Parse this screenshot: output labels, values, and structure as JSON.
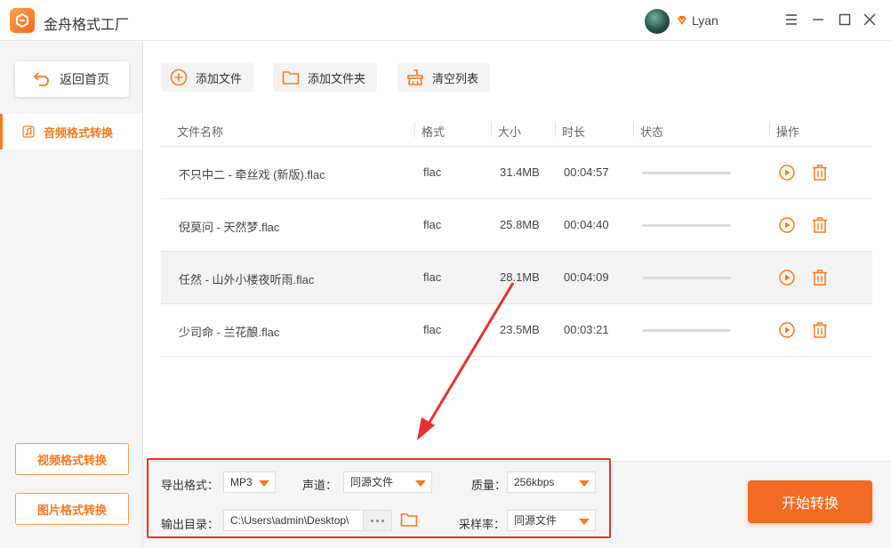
{
  "app": {
    "title": "金舟格式工厂"
  },
  "user": {
    "name": "Lyan"
  },
  "sidebar": {
    "back_label": "返回首页",
    "active_nav": "音频格式转换",
    "video_btn": "视频格式转换",
    "image_btn": "图片格式转换"
  },
  "toolbar": {
    "add_file": "添加文件",
    "add_folder": "添加文件夹",
    "clear_list": "清空列表"
  },
  "table": {
    "headers": {
      "name": "文件名称",
      "format": "格式",
      "size": "大小",
      "duration": "时长",
      "status": "状态",
      "action": "操作"
    },
    "rows": [
      {
        "name": "不只中二 - 牵丝戏 (新版).flac",
        "format": "flac",
        "size": "31.4MB",
        "duration": "00:04:57"
      },
      {
        "name": "倪莫问 - 天然梦.flac",
        "format": "flac",
        "size": "25.8MB",
        "duration": "00:04:40"
      },
      {
        "name": "任然 - 山外小楼夜听雨.flac",
        "format": "flac",
        "size": "28.1MB",
        "duration": "00:04:09"
      },
      {
        "name": "少司命 - 兰花酿.flac",
        "format": "flac",
        "size": "23.5MB",
        "duration": "00:03:21"
      }
    ]
  },
  "settings": {
    "export_format_label": "导出格式：",
    "export_format_value": "MP3",
    "channel_label": "声道：",
    "channel_value": "同源文件",
    "quality_label": "质量：",
    "quality_value": "256kbps",
    "output_dir_label": "输出目录：",
    "output_dir_value": "C:\\Users\\admin\\Desktop\\",
    "sample_rate_label": "采样率：",
    "sample_rate_value": "同源文件"
  },
  "start_button": "开始转换",
  "colors": {
    "accent": "#f7791e",
    "start": "#f26a23",
    "annotation": "#e8312c"
  }
}
